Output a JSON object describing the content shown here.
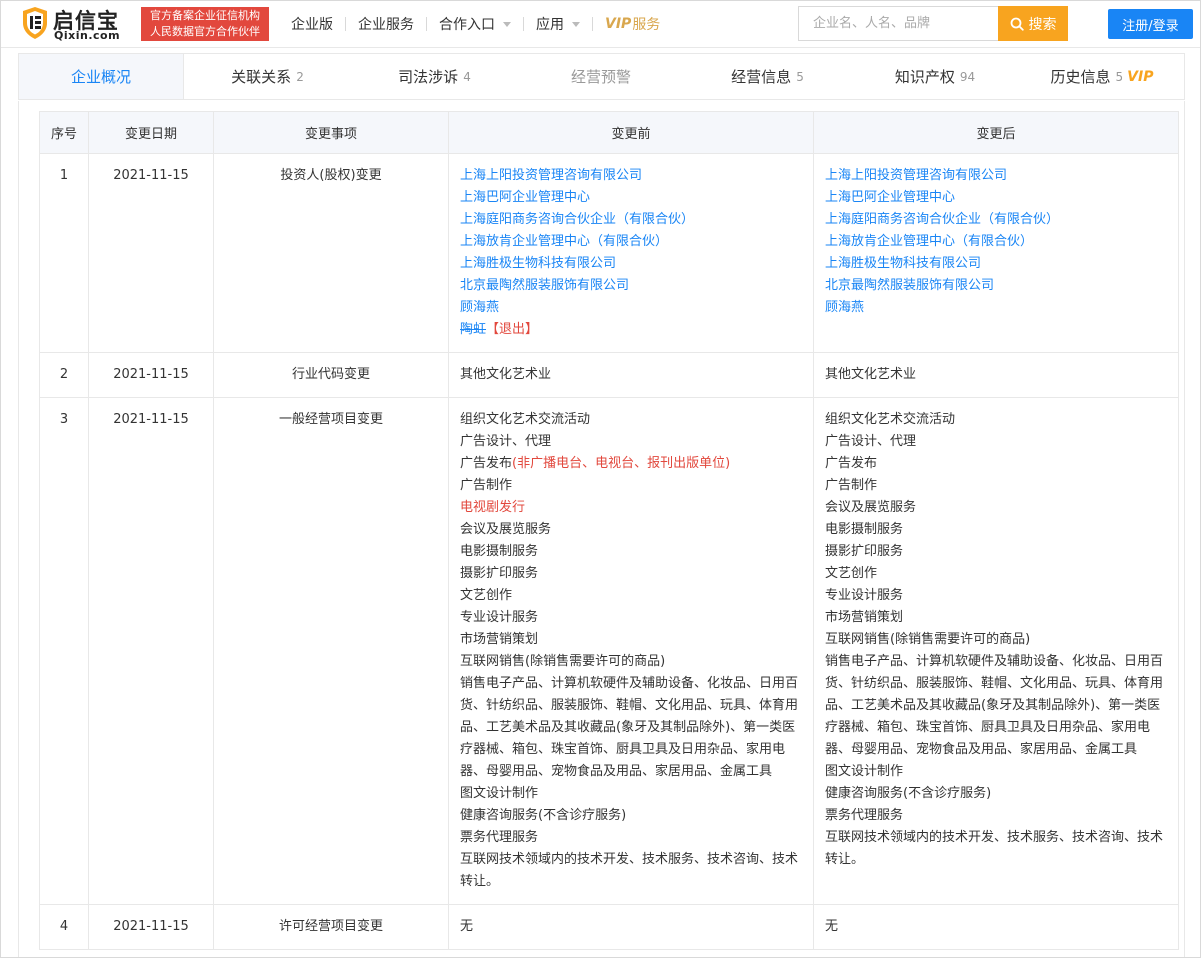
{
  "header": {
    "logo_name": "启信宝",
    "logo_domain": "Qixin.com",
    "badge_line1": "官方备案企业征信机构",
    "badge_line2": "人民数据官方合作伙伴",
    "nav": {
      "enterprise_edition": "企业版",
      "enterprise_service": "企业服务",
      "partner_entry": "合作入口",
      "apps": "应用",
      "vip_label": "VIP",
      "vip_service": "服务"
    },
    "search_placeholder": "企业名、人名、品牌",
    "search_button": "搜索",
    "login_button": "注册/登录"
  },
  "tabs": [
    {
      "label": "企业概况",
      "count": ""
    },
    {
      "label": "关联关系",
      "count": "2"
    },
    {
      "label": "司法涉诉",
      "count": "4"
    },
    {
      "label": "经营预警",
      "count": ""
    },
    {
      "label": "经营信息",
      "count": "5"
    },
    {
      "label": "知识产权",
      "count": "94"
    },
    {
      "label": "历史信息",
      "count": "5",
      "badge": "VIP"
    }
  ],
  "table": {
    "headers": [
      "序号",
      "变更日期",
      "变更事项",
      "变更前",
      "变更后"
    ],
    "rows": [
      {
        "no": "1",
        "date": "2021-11-15",
        "item": "投资人(股权)变更",
        "before": [
          "上海上阳投资管理咨询有限公司",
          "上海巴阿企业管理中心",
          "上海庭阳商务咨询合伙企业（有限合伙）",
          "上海放肯企业管理中心（有限合伙）",
          "上海胜极生物科技有限公司",
          "北京最陶然服装服饰有限公司",
          "顾海燕"
        ],
        "before_exit_name": "陶虹",
        "before_exit_tag": "【退出】",
        "after": [
          "上海上阳投资管理咨询有限公司",
          "上海巴阿企业管理中心",
          "上海庭阳商务咨询合伙企业（有限合伙）",
          "上海放肯企业管理中心（有限合伙）",
          "上海胜极生物科技有限公司",
          "北京最陶然服装服饰有限公司",
          "顾海燕"
        ]
      },
      {
        "no": "2",
        "date": "2021-11-15",
        "item": "行业代码变更",
        "before": "其他文化艺术业",
        "after": "其他文化艺术业"
      },
      {
        "no": "3",
        "date": "2021-11-15",
        "item": "一般经营项目变更",
        "before_l1": "组织文化艺术交流活动",
        "before_l2": "广告设计、代理",
        "before_l3a": "广告发布",
        "before_l3b": "(非广播电台、电视台、报刊出版单位)",
        "before_l4": "广告制作",
        "before_l5": "电视剧发行",
        "before_l6": "会议及展览服务",
        "before_l7": "电影摄制服务",
        "before_l8": "摄影扩印服务",
        "before_l9": "文艺创作",
        "before_l10": "专业设计服务",
        "before_l11": "市场营销策划",
        "before_l12": "互联网销售(除销售需要许可的商品)",
        "before_l13": "销售电子产品、计算机软硬件及辅助设备、化妆品、日用百货、针纺织品、服装服饰、鞋帽、文化用品、玩具、体育用品、工艺美术品及其收藏品(象牙及其制品除外)、第一类医疗器械、箱包、珠宝首饰、厨具卫具及日用杂品、家用电器、母婴用品、宠物食品及用品、家居用品、金属工具",
        "before_l14": "图文设计制作",
        "before_l15": "健康咨询服务(不含诊疗服务)",
        "before_l16": "票务代理服务",
        "before_l17": "互联网技术领域内的技术开发、技术服务、技术咨询、技术转让。",
        "after_l1": "组织文化艺术交流活动",
        "after_l2": "广告设计、代理",
        "after_l3": "广告发布",
        "after_l4": "广告制作",
        "after_l5": "会议及展览服务",
        "after_l6": "电影摄制服务",
        "after_l7": "摄影扩印服务",
        "after_l8": "文艺创作",
        "after_l9": "专业设计服务",
        "after_l10": "市场营销策划",
        "after_l11": "互联网销售(除销售需要许可的商品)",
        "after_l12": "销售电子产品、计算机软硬件及辅助设备、化妆品、日用百货、针纺织品、服装服饰、鞋帽、文化用品、玩具、体育用品、工艺美术品及其收藏品(象牙及其制品除外)、第一类医疗器械、箱包、珠宝首饰、厨具卫具及日用杂品、家用电器、母婴用品、宠物食品及用品、家居用品、金属工具",
        "after_l13": "图文设计制作",
        "after_l14": "健康咨询服务(不含诊疗服务)",
        "after_l15": "票务代理服务",
        "after_l16": "互联网技术领域内的技术开发、技术服务、技术咨询、技术转让。"
      },
      {
        "no": "4",
        "date": "2021-11-15",
        "item": "许可经营项目变更",
        "before": "无",
        "after": "无"
      }
    ]
  },
  "colors": {
    "brand_blue": "#1985f5",
    "search_orange": "#f8a41f",
    "badge_red": "#e2483d",
    "vip_gold": "#d9a74e"
  }
}
